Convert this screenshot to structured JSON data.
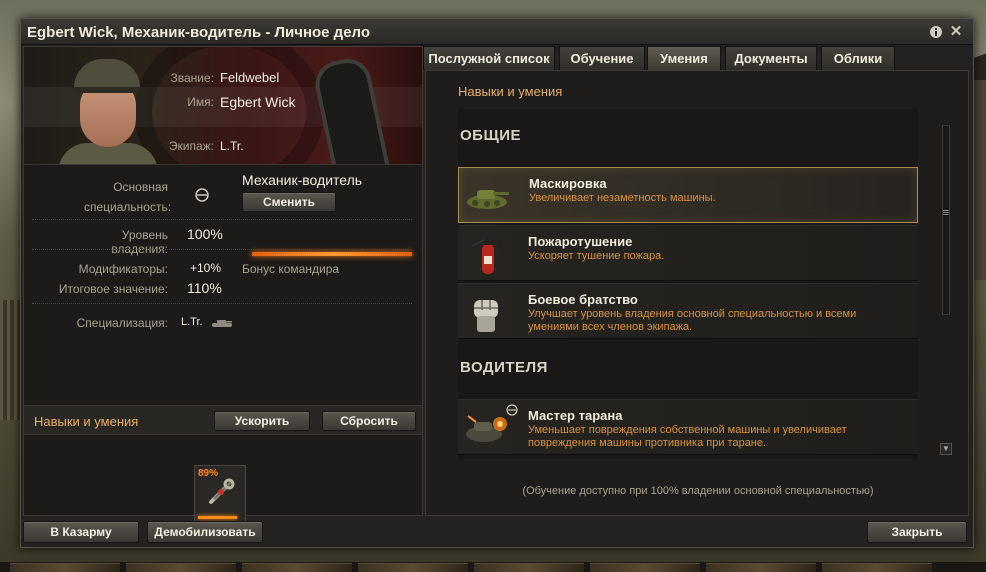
{
  "window": {
    "title": "Egbert Wick, Механик-водитель - Личное дело",
    "info_icon": "info-icon",
    "close_icon": "close-icon"
  },
  "profile": {
    "rank_label": "Звание:",
    "rank_value": "Feldwebel",
    "name_label": "Имя:",
    "name_value": "Egbert Wick",
    "crew_label": "Экипаж:",
    "crew_value": "L.Tr."
  },
  "specialty": {
    "label": "Основная специальность:",
    "value": "Механик-водитель",
    "change_button": "Сменить",
    "mastery_label": "Уровень владения:",
    "mastery_value": "100%",
    "mastery_level": 1.0,
    "modifiers_label": "Модификаторы:",
    "modifiers_value": "+10%",
    "modifiers_note": "Бонус командира",
    "total_label": "Итоговое значение:",
    "total_value": "110%",
    "specialization_label": "Специализация:",
    "specialization_value": "L.Tr."
  },
  "left_skills": {
    "title": "Навыки и умения",
    "accelerate_button": "Ускорить",
    "reset_button": "Сбросить",
    "slot_percent": "89%",
    "slot_progress": 0.89
  },
  "footer": {
    "barracks_button": "В Казарму",
    "demobilize_button": "Демобилизовать",
    "close_button": "Закрыть"
  },
  "tabs": [
    {
      "label": "Послужной список",
      "active": false
    },
    {
      "label": "Обучение",
      "active": false
    },
    {
      "label": "Умения",
      "active": true
    },
    {
      "label": "Документы",
      "active": false
    },
    {
      "label": "Облики",
      "active": false
    }
  ],
  "skills_panel": {
    "title": "Навыки и умения",
    "categories": [
      {
        "name": "ОБЩИЕ",
        "items": [
          {
            "name": "Маскировка",
            "desc": "Увеличивает незаметность машины.",
            "icon": "camouflage-tank-icon",
            "selected": true
          },
          {
            "name": "Пожаротушение",
            "desc": "Ускоряет тушение пожара.",
            "icon": "fire-extinguisher-icon",
            "selected": false
          },
          {
            "name": "Боевое братство",
            "desc": "Улучшает уровень владения основной специальностью и всеми умениями всех членов экипажа.",
            "icon": "fist-icon",
            "selected": false
          }
        ]
      },
      {
        "name": "ВОДИТЕЛЯ",
        "items": [
          {
            "name": "Мастер тарана",
            "desc": "Уменьшает повреждения собственной машины и увеличивает повреждения машины противника при таране.",
            "icon": "ramming-tank-icon",
            "selected": false
          }
        ]
      }
    ],
    "note": "(Обучение доступно при 100% владении основной специальностью)"
  },
  "colors": {
    "accent_orange": "#e8b06a",
    "desc_orange": "#d9923f",
    "progress": "#ff8a1a"
  }
}
